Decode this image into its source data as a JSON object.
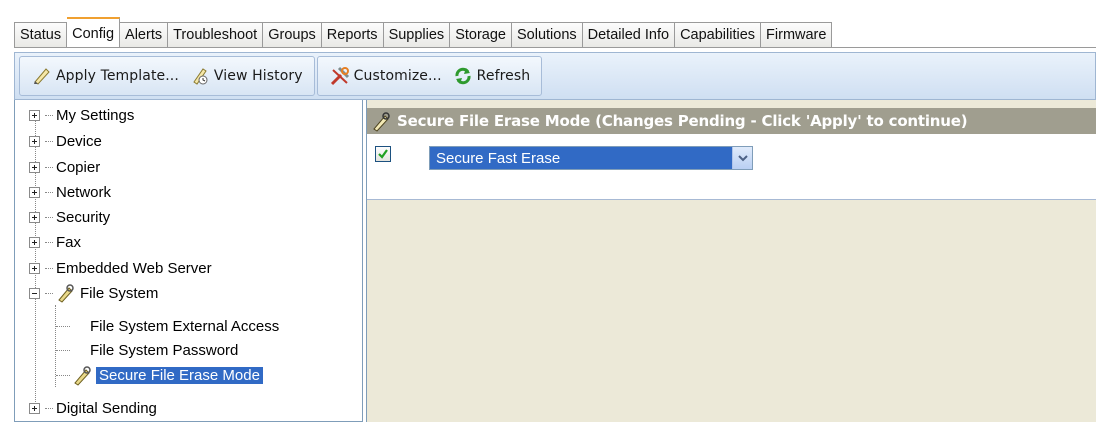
{
  "tabs": [
    {
      "label": "Status",
      "active": false
    },
    {
      "label": "Config",
      "active": true
    },
    {
      "label": "Alerts",
      "active": false
    },
    {
      "label": "Troubleshoot",
      "active": false
    },
    {
      "label": "Groups",
      "active": false
    },
    {
      "label": "Reports",
      "active": false
    },
    {
      "label": "Supplies",
      "active": false
    },
    {
      "label": "Storage",
      "active": false
    },
    {
      "label": "Solutions",
      "active": false
    },
    {
      "label": "Detailed Info",
      "active": false
    },
    {
      "label": "Capabilities",
      "active": false
    },
    {
      "label": "Firmware",
      "active": false
    }
  ],
  "toolbar": {
    "apply_template": {
      "label": "Apply Template...",
      "icon": "template-icon"
    },
    "view_history": {
      "label": "View History",
      "icon": "history-icon"
    },
    "customize": {
      "label": "Customize...",
      "icon": "tools-icon"
    },
    "refresh": {
      "label": "Refresh",
      "icon": "refresh-icon"
    }
  },
  "tree": {
    "items": [
      {
        "label": "My Settings",
        "expander": "plus"
      },
      {
        "label": "Device",
        "expander": "plus"
      },
      {
        "label": "Copier",
        "expander": "plus"
      },
      {
        "label": "Network",
        "expander": "plus"
      },
      {
        "label": "Security",
        "expander": "plus"
      },
      {
        "label": "Fax",
        "expander": "plus"
      },
      {
        "label": "Embedded Web Server",
        "expander": "plus"
      },
      {
        "label": "File System",
        "expander": "minus",
        "icon": "settings-wrench-icon"
      },
      {
        "label": "File System External Access",
        "child": true
      },
      {
        "label": "File System Password",
        "child": true
      },
      {
        "label": "Secure File Erase Mode",
        "child": true,
        "selected": true,
        "icon": "settings-wrench-icon"
      },
      {
        "label": "Digital Sending",
        "expander": "plus"
      }
    ]
  },
  "detail": {
    "header": "Secure File Erase Mode (Changes Pending - Click 'Apply' to continue)",
    "checkbox_checked": true,
    "select_value": "Secure Fast Erase"
  },
  "colors": {
    "selection": "#316ac5",
    "header_bar": "#a09e8f",
    "panel_bg": "#ece9d8",
    "toolbar": "#cfdff2"
  }
}
